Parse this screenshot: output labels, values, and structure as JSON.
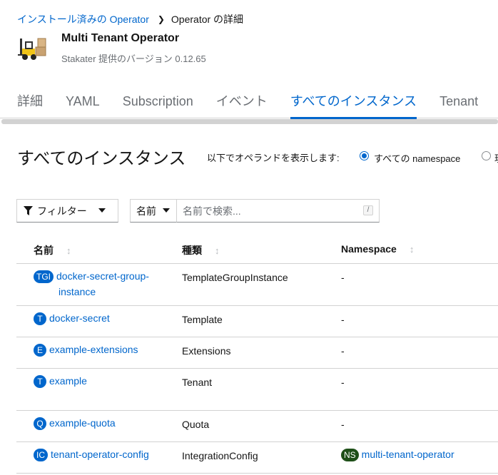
{
  "breadcrumb": {
    "parent": "インストール済みの Operator",
    "current": "Operator の詳細"
  },
  "operator": {
    "title": "Multi Tenant Operator",
    "subtitle": "Stakater 提供のバージョン 0.12.65"
  },
  "tabs": [
    "詳細",
    "YAML",
    "Subscription",
    "イベント",
    "すべてのインスタンス",
    "Tenant"
  ],
  "section_title": "すべてのインスタンス",
  "ns_filter": {
    "label": "以下でオペランドを表示します:",
    "option_all": "すべての namespace",
    "option_current": "現"
  },
  "toolbar": {
    "filter_label": "フィルター",
    "name_select": "名前",
    "search_placeholder": "名前で検索...",
    "shortcut": "/"
  },
  "table": {
    "headers": {
      "name": "名前",
      "kind": "種類",
      "namespace": "Namespace"
    },
    "rows": [
      {
        "badge": "TGI",
        "name_line1": "docker-secret-group-",
        "name_line2": "instance",
        "kind": "TemplateGroupInstance",
        "namespace": "-"
      },
      {
        "badge": "T",
        "name_line1": "docker-secret",
        "kind": "Template",
        "namespace": "-"
      },
      {
        "badge": "E",
        "name_line1": "example-extensions",
        "kind": "Extensions",
        "namespace": "-"
      },
      {
        "badge": "T",
        "name_line1": "example",
        "kind": "Tenant",
        "namespace": "-"
      },
      {
        "badge": "Q",
        "name_line1": "example-quota",
        "kind": "Quota",
        "namespace": "-"
      },
      {
        "badge": "IC",
        "name_line1": "tenant-operator-config",
        "kind": "IntegrationConfig",
        "ns_badge": "NS",
        "namespace": "multi-tenant-operator"
      }
    ]
  },
  "colors": {
    "link": "#0066cc",
    "ns_badge": "#1e4f18"
  },
  "icons": [
    "forklift-logo-icon",
    "chevron-right-icon",
    "filter-icon",
    "caret-down-icon",
    "sort-icon"
  ]
}
